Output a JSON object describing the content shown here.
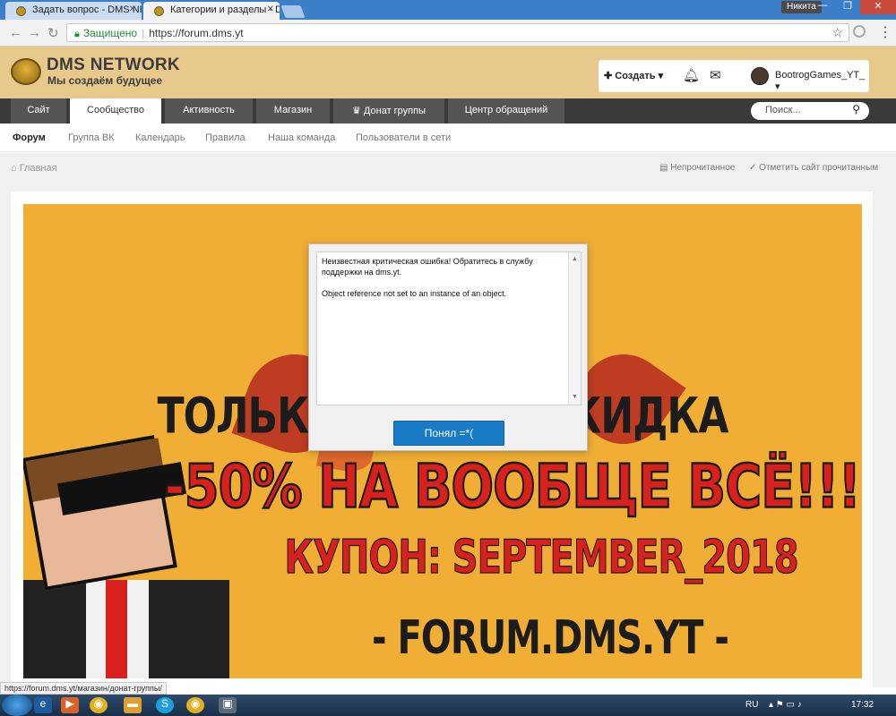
{
  "browser": {
    "tabs": [
      {
        "title": "Задать вопрос - DMS NE",
        "active": false
      },
      {
        "title": "Категории и разделы - D",
        "active": true
      }
    ],
    "profile_name": "Никита",
    "secure_label": "Защищено",
    "url": "https://forum.dms.yt",
    "status_url": "https://forum.dms.yt/магазин/донат-группы/"
  },
  "site": {
    "brand": "DMS NETWORK",
    "tagline": "Мы создаём будущее",
    "user_bar": {
      "create_label": "Создать",
      "username": "BootrogGames_YT_"
    },
    "main_nav": [
      {
        "label": "Сайт",
        "active": false
      },
      {
        "label": "Сообщество",
        "active": true
      },
      {
        "label": "Активность",
        "active": false
      },
      {
        "label": "Магазин",
        "active": false
      },
      {
        "label": "Донат группы",
        "active": false
      },
      {
        "label": "Центр обращений",
        "active": false
      }
    ],
    "search_placeholder": "Поиск...",
    "sub_nav": [
      {
        "label": "Форум",
        "active": true
      },
      {
        "label": "Группа ВК",
        "active": false
      },
      {
        "label": "Календарь",
        "active": false
      },
      {
        "label": "Правила",
        "active": false
      },
      {
        "label": "Наша команда",
        "active": false
      },
      {
        "label": "Пользователи в сети",
        "active": false
      }
    ],
    "breadcrumb": "Главная",
    "unread_label": "Непрочитанное",
    "mark_read_label": "Отметить сайт прочитанным"
  },
  "banner": {
    "line1": "ТОЛЬКО СЕЙЧАС СКИДКА",
    "line2": "-50% НА ВООБЩЕ ВСЁ!!!!",
    "line3": "КУПОН: SEPTEMBER_2018",
    "line4": "- FORUM.DMS.YT -"
  },
  "dialog": {
    "message1": "Неизвестная критическая ошибка! Обратитесь в службу поддержки на dms.yt.",
    "message2": "Object reference not set to an instance of an object.",
    "button": "Понял =*("
  },
  "taskbar": {
    "language": "RU",
    "time": "17:32"
  },
  "colors": {
    "header_bg": "#e8c98c",
    "nav_bg": "#3a3a3a",
    "banner_bg": "#f0ae35",
    "accent_red": "#d8201c",
    "button_blue": "#1a7bc6"
  }
}
